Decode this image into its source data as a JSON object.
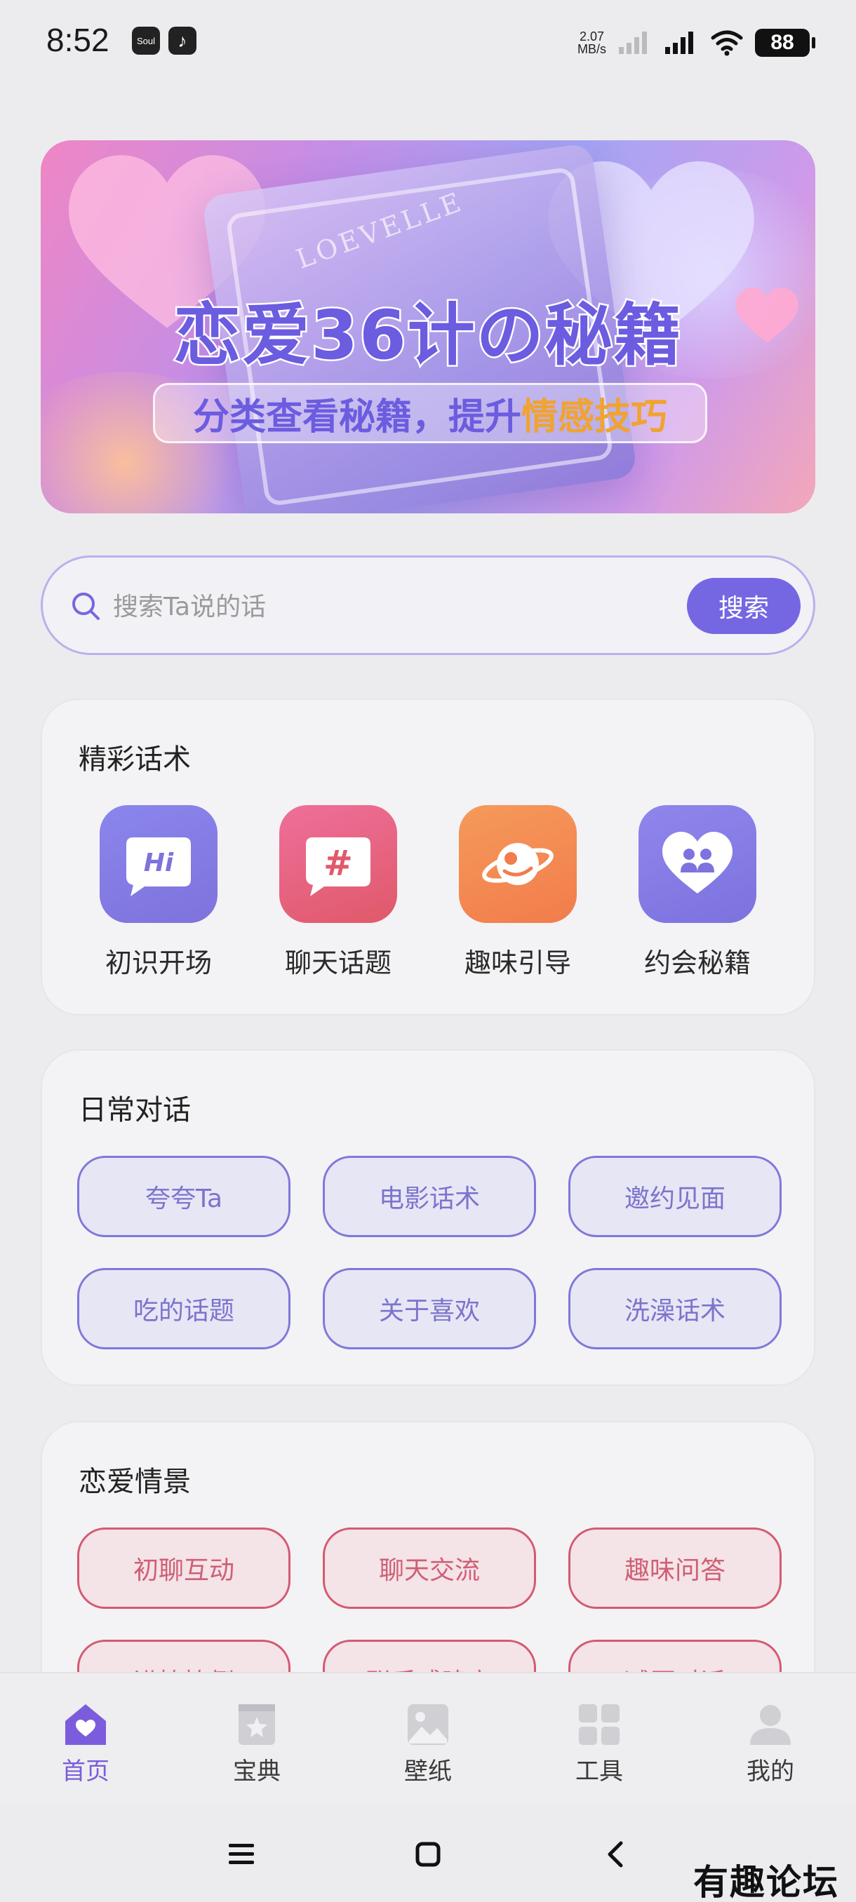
{
  "status_bar": {
    "time": "8:52",
    "app_badges": [
      "Soul",
      "♪"
    ],
    "net_speed_value": "2.07",
    "net_speed_unit": "MB/s",
    "battery": "88"
  },
  "banner": {
    "book_label": "LOEVELLE",
    "title": "恋爱36计の秘籍",
    "subtitle_prefix": "分类查看秘籍，提升",
    "subtitle_highlight": "情感技巧"
  },
  "search": {
    "placeholder": "搜索Ta说的话",
    "button_label": "搜索"
  },
  "sections": {
    "highlights": {
      "title": "精彩话术",
      "items": [
        {
          "label": "初识开场",
          "icon": "hi-chat-icon"
        },
        {
          "label": "聊天话题",
          "icon": "hashtag-chat-icon"
        },
        {
          "label": "趣味引导",
          "icon": "planet-icon"
        },
        {
          "label": "约会秘籍",
          "icon": "couple-heart-icon"
        }
      ]
    },
    "daily": {
      "title": "日常对话",
      "chips": [
        "夸夸Ta",
        "电影话术",
        "邀约见面",
        "吃的话题",
        "关于喜欢",
        "洗澡话术"
      ]
    },
    "love": {
      "title": "恋爱情景",
      "chips": [
        "初聊互动",
        "聊天交流",
        "趣味问答",
        "进撩撩倒",
        "联系感建立",
        "减压对话"
      ]
    }
  },
  "bottom_nav": [
    {
      "label": "首页",
      "icon": "home-heart-icon",
      "active": true
    },
    {
      "label": "宝典",
      "icon": "book-star-icon",
      "active": false
    },
    {
      "label": "壁纸",
      "icon": "image-icon",
      "active": false
    },
    {
      "label": "工具",
      "icon": "grid-icon",
      "active": false
    },
    {
      "label": "我的",
      "icon": "user-icon",
      "active": false
    }
  ],
  "watermark": "有趣论坛",
  "colors": {
    "accent": "#7567e2",
    "chip_purple": "#7f78da",
    "chip_red": "#d45a72",
    "highlight": "#f0a330"
  }
}
